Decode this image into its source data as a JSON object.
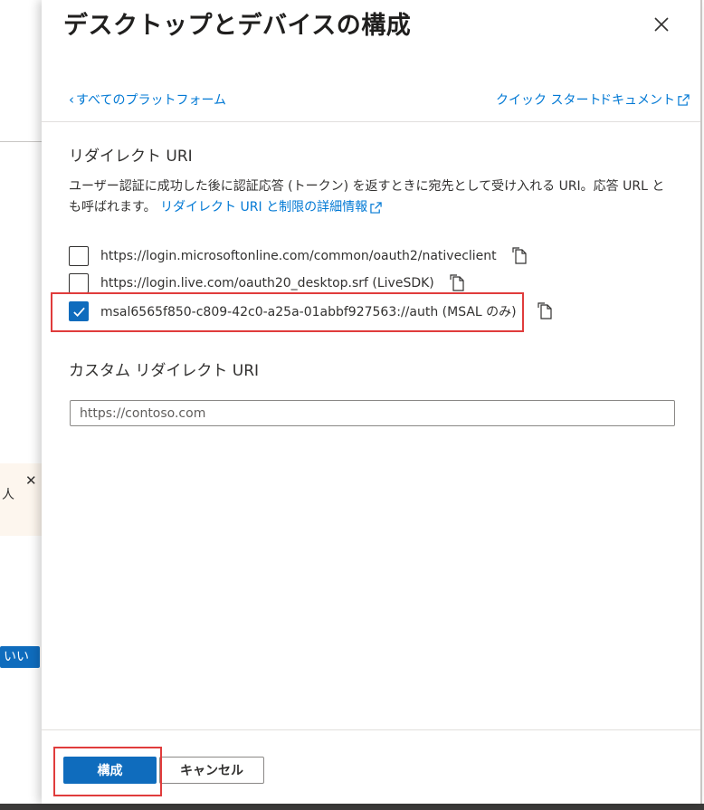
{
  "background": {
    "banner_text": "人",
    "no_button_label": "いいえ"
  },
  "panel": {
    "title": "デスクトップとデバイスの構成",
    "nav": {
      "back_label": "すべてのプラットフォーム",
      "quickstart_label": "クイック スタート",
      "docs_label": "ドキュメント"
    },
    "redirect_section": {
      "heading": "リダイレクト URI",
      "description": "ユーザー認証に成功した後に認証応答 (トークン) を返すときに宛先として受け入れる URI。応答 URL とも呼ばれます。",
      "link_label": "リダイレクト URI と制限の詳細情報",
      "uris": [
        {
          "value": "https://login.microsoftonline.com/common/oauth2/nativeclient",
          "checked": false
        },
        {
          "value": "https://login.live.com/oauth20_desktop.srf (LiveSDK)",
          "checked": false
        },
        {
          "value": "msal6565f850-c809-42c0-a25a-01abbf927563://auth (MSAL のみ)",
          "checked": true
        }
      ]
    },
    "custom_section": {
      "heading": "カスタム リダイレクト URI",
      "placeholder": "https://contoso.com",
      "value": ""
    },
    "footer": {
      "configure_label": "構成",
      "cancel_label": "キャンセル"
    }
  },
  "colors": {
    "accent": "#0f6cbd",
    "link": "#0078d4",
    "highlight": "#e03c3c"
  }
}
